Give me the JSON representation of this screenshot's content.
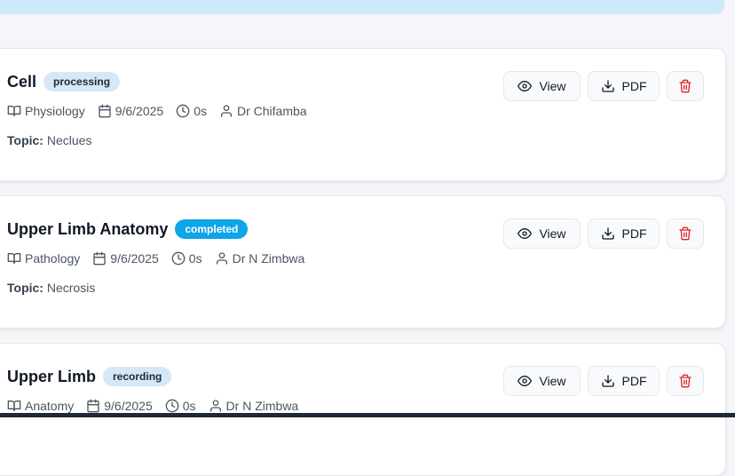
{
  "cards": [
    {
      "title": "Cell",
      "status": "processing",
      "subject": "Physiology",
      "date": "9/6/2025",
      "duration": "0s",
      "lecturer": "Dr Chifamba",
      "topic_label": "Topic:",
      "topic": "Neclues"
    },
    {
      "title": "Upper Limb Anatomy",
      "status": "completed",
      "subject": "Pathology",
      "date": "9/6/2025",
      "duration": "0s",
      "lecturer": "Dr N Zimbwa",
      "topic_label": "Topic:",
      "topic": "Necrosis"
    },
    {
      "title": "Upper Limb",
      "status": "recording",
      "subject": "Anatomy",
      "date": "9/6/2025",
      "duration": "0s",
      "lecturer": "Dr N Zimbwa"
    }
  ],
  "actions": {
    "view_label": "View",
    "pdf_label": "PDF",
    "delete_icon": "trash-icon"
  },
  "colors": {
    "completed_badge": "#0ea5e9",
    "badge_light": "#d6e7f7",
    "delete": "#dc2626",
    "banner": "#cde8f7"
  }
}
